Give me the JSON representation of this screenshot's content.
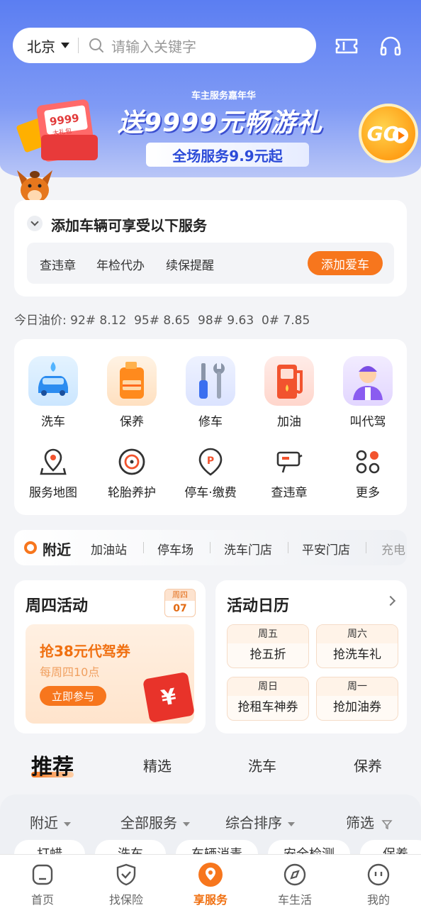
{
  "header": {
    "city": "北京",
    "search_placeholder": "请输入关键字"
  },
  "banner": {
    "small_text": "车主服务嘉年华",
    "main_text": "送9999元畅游礼",
    "sub_text": "全场服务9.9元起",
    "go_label": "GO",
    "gift_label": "9999",
    "gift_sub": "大礼包"
  },
  "add_vehicle": {
    "title": "添加车辆可享受以下服务",
    "services": [
      "查违章",
      "年检代办",
      "续保提醒"
    ],
    "button": "添加爱车"
  },
  "oil_prices": {
    "label": "今日油价:",
    "text": "92# 8.12  95# 8.65  98# 9.63  0# 7.85"
  },
  "services_grid": {
    "row1": [
      "洗车",
      "保养",
      "修车",
      "加油",
      "叫代驾"
    ],
    "row2": [
      "服务地图",
      "轮胎养护",
      "停车·缴费",
      "查违章",
      "更多"
    ]
  },
  "nearby": {
    "title": "附近",
    "tabs": [
      "加油站",
      "停车场",
      "洗车门店",
      "平安门店",
      "充电"
    ]
  },
  "thursday": {
    "title": "周四活动",
    "badge_week": "周四",
    "badge_day": "07",
    "promo_title": "抢38元代驾券",
    "promo_sub": "每周四10点",
    "promo_button": "立即参与",
    "envelope": "¥"
  },
  "calendar": {
    "title": "活动日历",
    "items": [
      {
        "week": "周五",
        "text": "抢五折"
      },
      {
        "week": "周六",
        "text": "抢洗车礼"
      },
      {
        "week": "周日",
        "text": "抢租车神券"
      },
      {
        "week": "周一",
        "text": "抢加油券"
      }
    ]
  },
  "recommend": {
    "title": "推荐",
    "tabs": [
      "精选",
      "洗车",
      "保养"
    ]
  },
  "filters": {
    "items": [
      "附近",
      "全部服务",
      "综合排序",
      "筛选"
    ],
    "chips": [
      "打蜡",
      "洗车",
      "车辆消毒",
      "安全检测",
      "保养"
    ]
  },
  "tabbar": {
    "items": [
      "首页",
      "找保险",
      "享服务",
      "车生活",
      "我的"
    ],
    "active": 2
  },
  "colors": {
    "accent": "#f7761d",
    "header_blue": "#5b7ef2"
  }
}
